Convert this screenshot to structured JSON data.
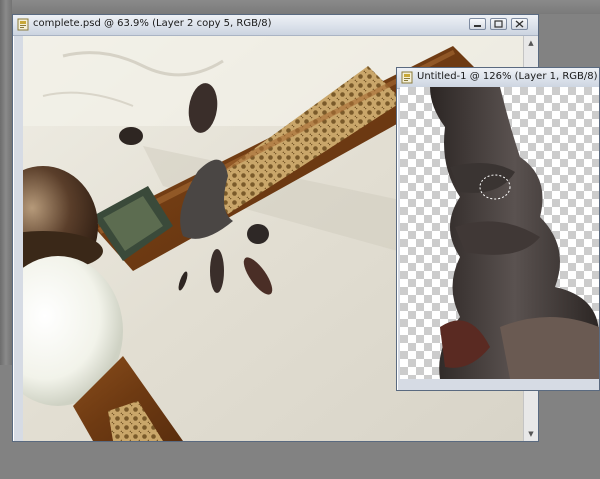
{
  "windows": {
    "main": {
      "title": "complete.psd @ 63.9% (Layer 2 copy 5, RGB/8)"
    },
    "secondary": {
      "title": "Untitled-1 @ 126% (Layer 1, RGB/8)"
    }
  },
  "icons": {
    "document": "photoshop-document-icon",
    "minimize": "minimize-icon",
    "maximize": "maximize-icon",
    "close": "close-icon",
    "scroll_up": "scroll-up-arrow-icon",
    "scroll_down": "scroll-down-arrow-icon"
  },
  "colors": {
    "desktop": "#828282",
    "titlebar": "#dde3ec",
    "wood": "#7a4418",
    "ceiling": "#e6e3d8"
  }
}
